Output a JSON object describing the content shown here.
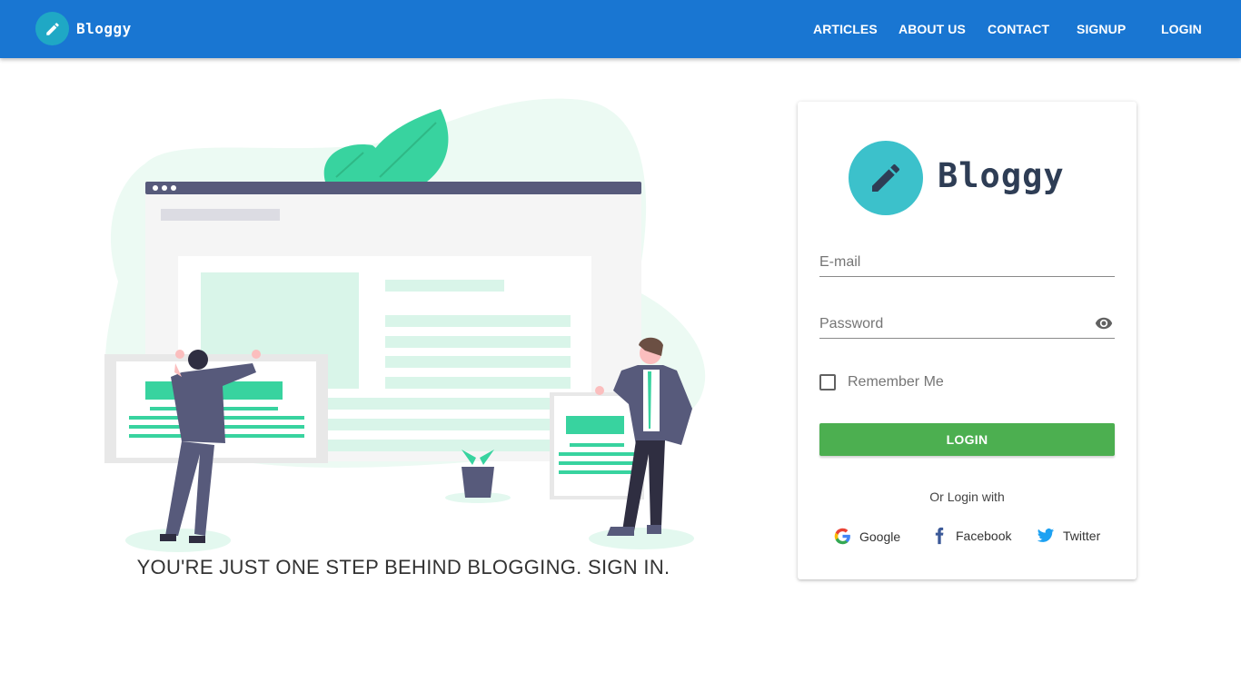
{
  "header": {
    "brand": "Bloggy",
    "nav": [
      "ARTICLES",
      "ABOUT US",
      "CONTACT",
      "SIGNUP",
      "LOGIN"
    ],
    "color": "#1976d2"
  },
  "hero": {
    "tagline": "YOU'RE JUST ONE STEP BEHIND BLOGGING. SIGN IN."
  },
  "login_card": {
    "brand": "Bloggy",
    "email_placeholder": "E-mail",
    "password_placeholder": "Password",
    "remember_label": "Remember Me",
    "login_button": "LOGIN",
    "button_color": "#4caf50",
    "or_text": "Or Login with",
    "social": [
      {
        "label": "Google",
        "icon": "google-icon"
      },
      {
        "label": "Facebook",
        "icon": "facebook-icon"
      },
      {
        "label": "Twitter",
        "icon": "twitter-icon"
      }
    ]
  }
}
